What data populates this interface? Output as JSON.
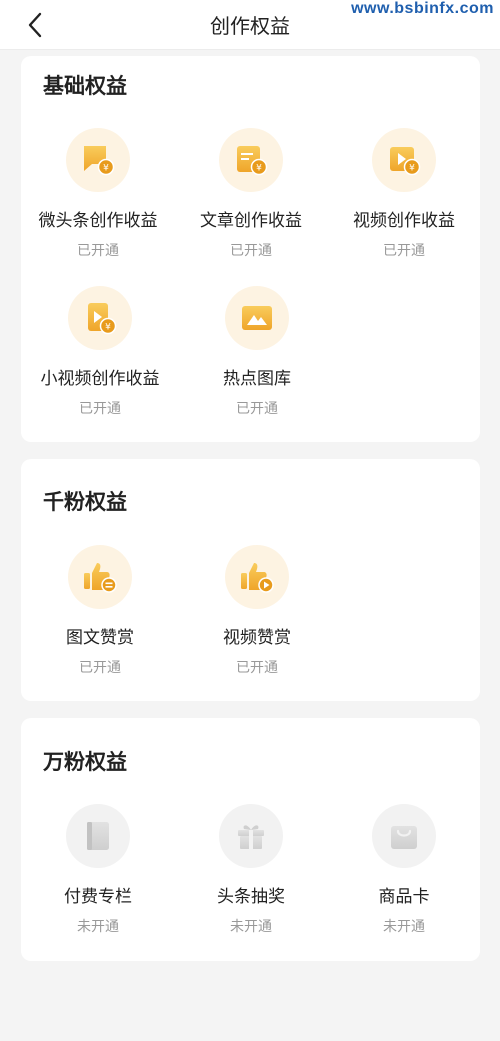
{
  "nav": {
    "title": "创作权益",
    "back_icon": "chevron-left-icon"
  },
  "watermark": "www.bsbinfx.com",
  "colors": {
    "accent_light": "#f6c14a",
    "accent_dark": "#e79a1c",
    "disabled": "#d4d4d4"
  },
  "sections": [
    {
      "title": "基础权益",
      "items": [
        {
          "label": "微头条创作收益",
          "status": "已开通",
          "icon": "chat-bubble-yen-icon"
        },
        {
          "label": "文章创作收益",
          "status": "已开通",
          "icon": "document-yen-icon"
        },
        {
          "label": "视频创作收益",
          "status": "已开通",
          "icon": "video-yen-icon"
        },
        {
          "label": "小视频创作收益",
          "status": "已开通",
          "icon": "short-video-yen-icon"
        },
        {
          "label": "热点图库",
          "status": "已开通",
          "icon": "picture-icon"
        }
      ]
    },
    {
      "title": "千粉权益",
      "items": [
        {
          "label": "图文赞赏",
          "status": "已开通",
          "icon": "thumbs-up-text-icon"
        },
        {
          "label": "视频赞赏",
          "status": "已开通",
          "icon": "thumbs-up-video-icon"
        }
      ]
    },
    {
      "title": "万粉权益",
      "items": [
        {
          "label": "付费专栏",
          "status": "未开通",
          "icon": "book-icon"
        },
        {
          "label": "头条抽奖",
          "status": "未开通",
          "icon": "gift-box-icon"
        },
        {
          "label": "商品卡",
          "status": "未开通",
          "icon": "shopping-bag-icon"
        }
      ]
    }
  ]
}
